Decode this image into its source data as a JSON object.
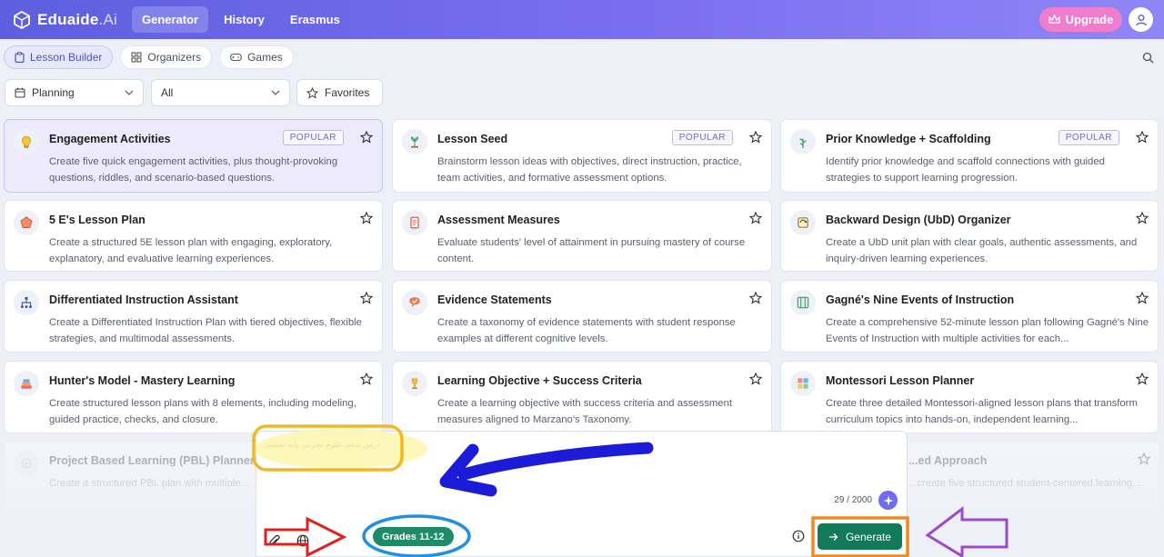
{
  "brand": {
    "name": "Eduaide",
    "suffix": ".Ai"
  },
  "nav": {
    "items": [
      "Generator",
      "History",
      "Erasmus"
    ]
  },
  "header": {
    "upgrade_label": "Upgrade"
  },
  "subtabs": [
    "Lesson Builder",
    "Organizers",
    "Games"
  ],
  "filters": {
    "category": "Planning",
    "scope": "All",
    "favorites": "Favorites"
  },
  "cards": [
    {
      "title": "Engagement Activities",
      "desc": "Create five quick engagement activities, plus thought-provoking questions, riddles, and scenario-based questions.",
      "badge": "POPULAR"
    },
    {
      "title": "Lesson Seed",
      "desc": "Brainstorm lesson ideas with objectives, direct instruction, practice, team activities, and formative assessment options.",
      "badge": "POPULAR"
    },
    {
      "title": "Prior Knowledge + Scaffolding",
      "desc": "Identify prior knowledge and scaffold connections with guided strategies to support learning progression.",
      "badge": "POPULAR"
    },
    {
      "title": "5 E's Lesson Plan",
      "desc": "Create a structured 5E lesson plan with engaging, exploratory, explanatory, and evaluative learning experiences.",
      "badge": ""
    },
    {
      "title": "Assessment Measures",
      "desc": "Evaluate students' level of attainment in pursuing mastery of course content.",
      "badge": ""
    },
    {
      "title": "Backward Design (UbD) Organizer",
      "desc": "Create a UbD unit plan with clear goals, authentic assessments, and inquiry-driven learning experiences.",
      "badge": ""
    },
    {
      "title": "Differentiated Instruction Assistant",
      "desc": "Create a Differentiated Instruction Plan with tiered objectives, flexible strategies, and multimodal assessments.",
      "badge": ""
    },
    {
      "title": "Evidence Statements",
      "desc": "Create a taxonomy of evidence statements with student response examples at different cognitive levels.",
      "badge": ""
    },
    {
      "title": "Gagné's Nine Events of Instruction",
      "desc": "Create a comprehensive 52-minute lesson plan following Gagné's Nine Events of Instruction with multiple activities for each...",
      "badge": ""
    },
    {
      "title": "Hunter's Model - Mastery Learning",
      "desc": "Create structured lesson plans with 8 elements, including modeling, guided practice, checks, and closure.",
      "badge": ""
    },
    {
      "title": "Learning Objective + Success Criteria",
      "desc": "Create a learning objective with success criteria and assessment measures aligned to Marzano's Taxonomy.",
      "badge": ""
    },
    {
      "title": "Montessori Lesson Planner",
      "desc": "Create three detailed Montessori-aligned lesson plans that transform curriculum topics into hands-on, independent learning...",
      "badge": ""
    },
    {
      "title": "Project Based Learning (PBL) Planner",
      "desc": "Create a structured PBL plan with multiple...",
      "badge": ""
    },
    {
      "title": "...ed Approach",
      "desc": "...create five structured student-centered learning...",
      "badge": ""
    }
  ],
  "composer": {
    "prompt": "درس پنجم علوم تجربی پایه ششم",
    "counter": "29 / 2000",
    "grade": "Grades 11-12",
    "generate_label": "Generate"
  },
  "icons": [
    "logo-icon",
    "crown-icon",
    "user-icon",
    "clipboard-icon",
    "grid-icon",
    "gamepad-icon",
    "search-icon",
    "calendar-icon",
    "chevron-down-icon",
    "star-icon",
    "paperclip-icon",
    "globe-icon",
    "sparkle-icon",
    "info-icon",
    "arrow-right-icon"
  ],
  "colors": {
    "accent": "#6f6cf0",
    "generate": "#137a59",
    "grade": "#1f8a66",
    "upgrade": "#ef7ccc"
  }
}
